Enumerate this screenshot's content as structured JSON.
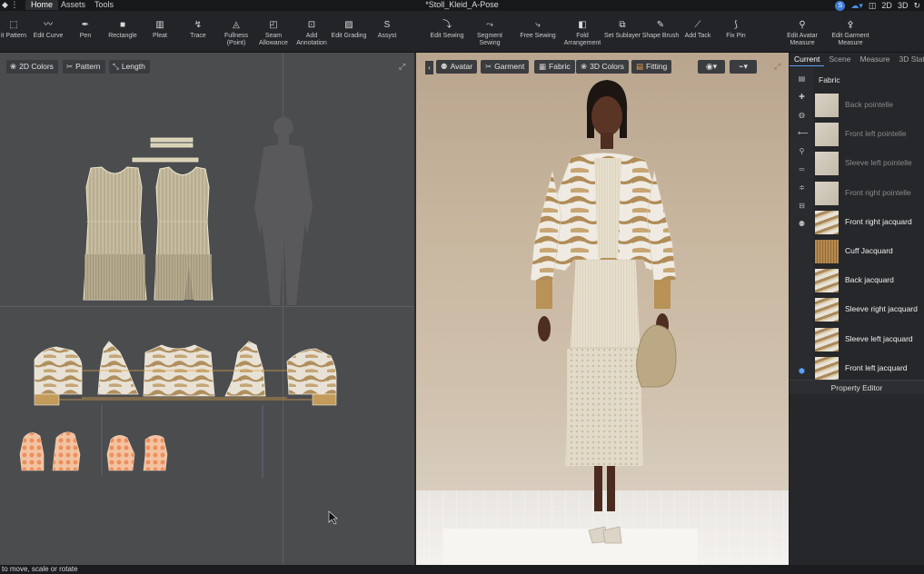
{
  "app": {
    "document_title": "*Stoll_Kleid_A-Pose",
    "menus": [
      {
        "label": "Home"
      },
      {
        "label": "Assets"
      },
      {
        "label": "Tools"
      }
    ],
    "top_right": {
      "badge": "S",
      "mode_2d": "2D",
      "mode_3d": "3D"
    }
  },
  "toolbar": {
    "tools": [
      {
        "label": "it Pattern"
      },
      {
        "label": "Edit Curve"
      },
      {
        "label": "Pen"
      },
      {
        "label": "Rectangle"
      },
      {
        "label": "Pleat"
      },
      {
        "label": "Trace"
      },
      {
        "label": "Fullness",
        "label2": "(Point)"
      },
      {
        "label": "Seam",
        "label2": "Allowance"
      },
      {
        "label": "Add",
        "label2": "Annotation"
      },
      {
        "label": "Edit Grading"
      },
      {
        "label": "Assyst"
      },
      {
        "label": "Edit Sewing"
      },
      {
        "label": "Segment",
        "label2": "Sewing"
      },
      {
        "label": "Free Sewing"
      },
      {
        "label": "Fold",
        "label2": "Arrangement"
      },
      {
        "label": "Set Sublayer"
      },
      {
        "label": "Shape Brush"
      },
      {
        "label": "Add Tack"
      },
      {
        "label": "Fix Pin"
      },
      {
        "label": "Edit Avatar",
        "label2": "Measure"
      },
      {
        "label": "Edit Garment",
        "label2": "Measure"
      }
    ]
  },
  "view2d": {
    "buttons": [
      {
        "label": "2D Colors"
      },
      {
        "label": "Pattern"
      },
      {
        "label": "Length"
      }
    ]
  },
  "view3d": {
    "tabs": [
      {
        "label": "Avatar"
      },
      {
        "label": "Garment"
      },
      {
        "label": "Fabric"
      },
      {
        "label": "3D Colors"
      },
      {
        "label": "Fitting"
      }
    ]
  },
  "right_panel": {
    "tabs": [
      {
        "label": "Current"
      },
      {
        "label": "Scene"
      },
      {
        "label": "Measure"
      },
      {
        "label": "3D Stat"
      }
    ],
    "section_title": "Fabric",
    "fabrics": [
      {
        "label": "Back pointelle",
        "state": "dim",
        "type": "plain"
      },
      {
        "label": "Front left pointelle",
        "state": "dim",
        "type": "plain"
      },
      {
        "label": "Sleeve left pointelle",
        "state": "dim",
        "type": "plain"
      },
      {
        "label": "Front right pointelle",
        "state": "dim",
        "type": "plain"
      },
      {
        "label": "Front right jacquard",
        "state": "bright",
        "type": "jacquard"
      },
      {
        "label": "Cuff Jacquard",
        "state": "bright",
        "type": "cuff"
      },
      {
        "label": "Back jacquard",
        "state": "bright",
        "type": "jacquard"
      },
      {
        "label": "Sleeve right jacquard",
        "state": "bright",
        "type": "jacquard"
      },
      {
        "label": "Sleeve left jacquard",
        "state": "bright",
        "type": "jacquard"
      },
      {
        "label": "Front left jacquard",
        "state": "bright",
        "type": "jacquard"
      }
    ],
    "property_editor": "Property Editor"
  },
  "status_bar": {
    "text": "to move, scale or rotate"
  },
  "colors": {
    "accent": "#5aa0ff",
    "pattern_outline": "#e9e3c8",
    "sewing_line": "#d9a14a",
    "puzzle_orange": "#ef9a6a"
  }
}
